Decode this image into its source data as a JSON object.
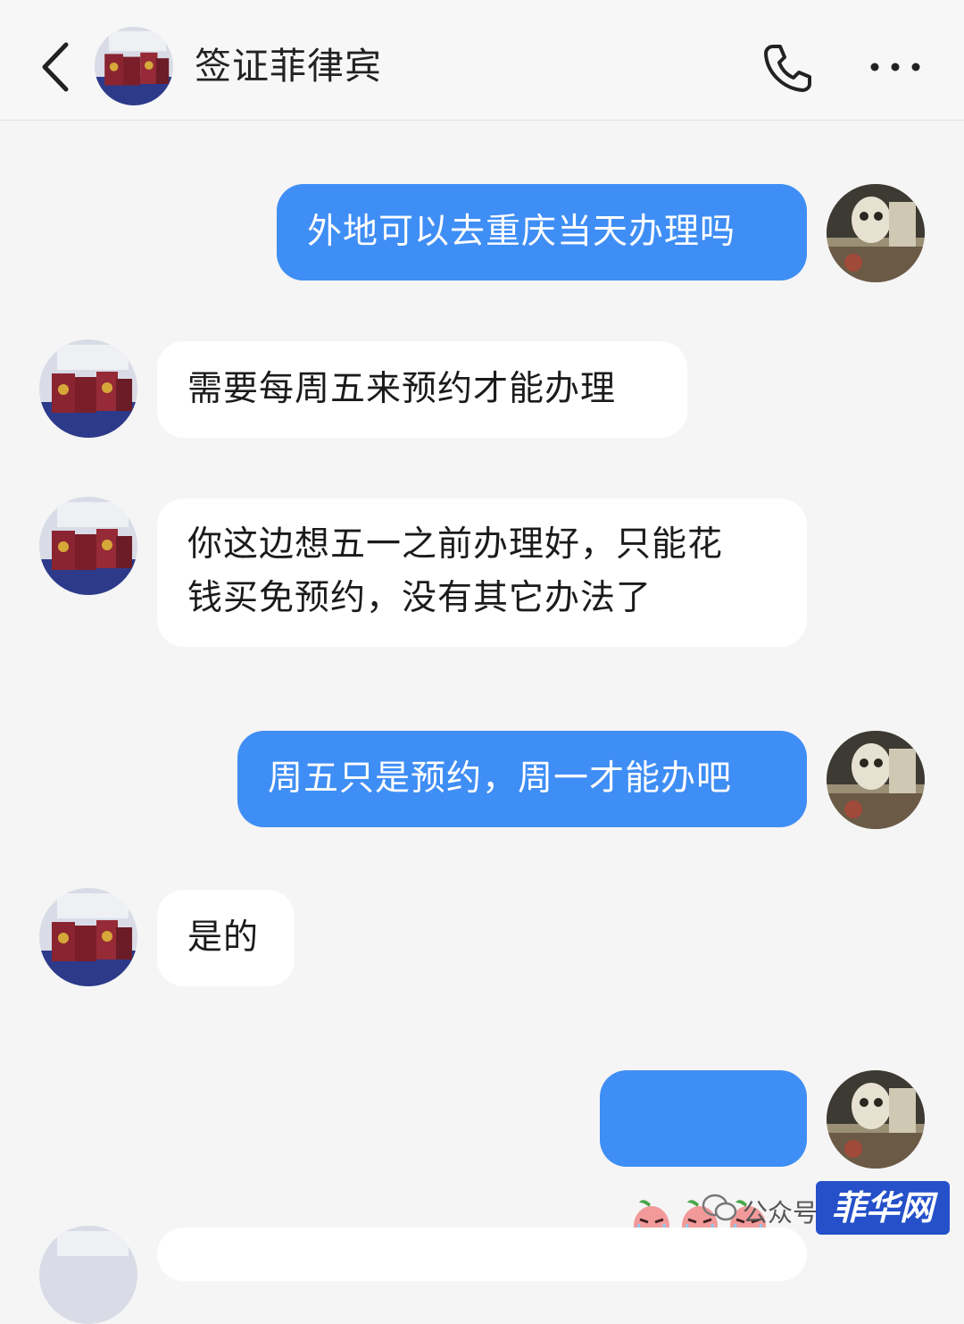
{
  "header": {
    "title": "签证菲律宾",
    "back_icon": "chevron-left-icon",
    "call_icon": "phone-icon",
    "more_icon": "more-dots-icon"
  },
  "messages": [
    {
      "side": "out",
      "text": "外地可以去重庆当天办理吗"
    },
    {
      "side": "in",
      "text": "需要每周五来预约才能办理"
    },
    {
      "side": "in",
      "text": "你这边想五一之前办理好，只能花\n钱买免预约，没有其它办法了"
    },
    {
      "side": "out",
      "text": "周五只是预约，周一才能办吧"
    },
    {
      "side": "in",
      "text": "是的"
    },
    {
      "side": "out",
      "emoji": [
        "crying-face-emoji",
        "crying-face-emoji",
        "crying-face-emoji"
      ]
    }
  ],
  "watermark": {
    "prefix": "公众号",
    "brand": "菲华网"
  },
  "colors": {
    "outgoing_bubble": "#3f8ef5",
    "incoming_bubble": "#ffffff",
    "background": "#f5f5f5"
  }
}
